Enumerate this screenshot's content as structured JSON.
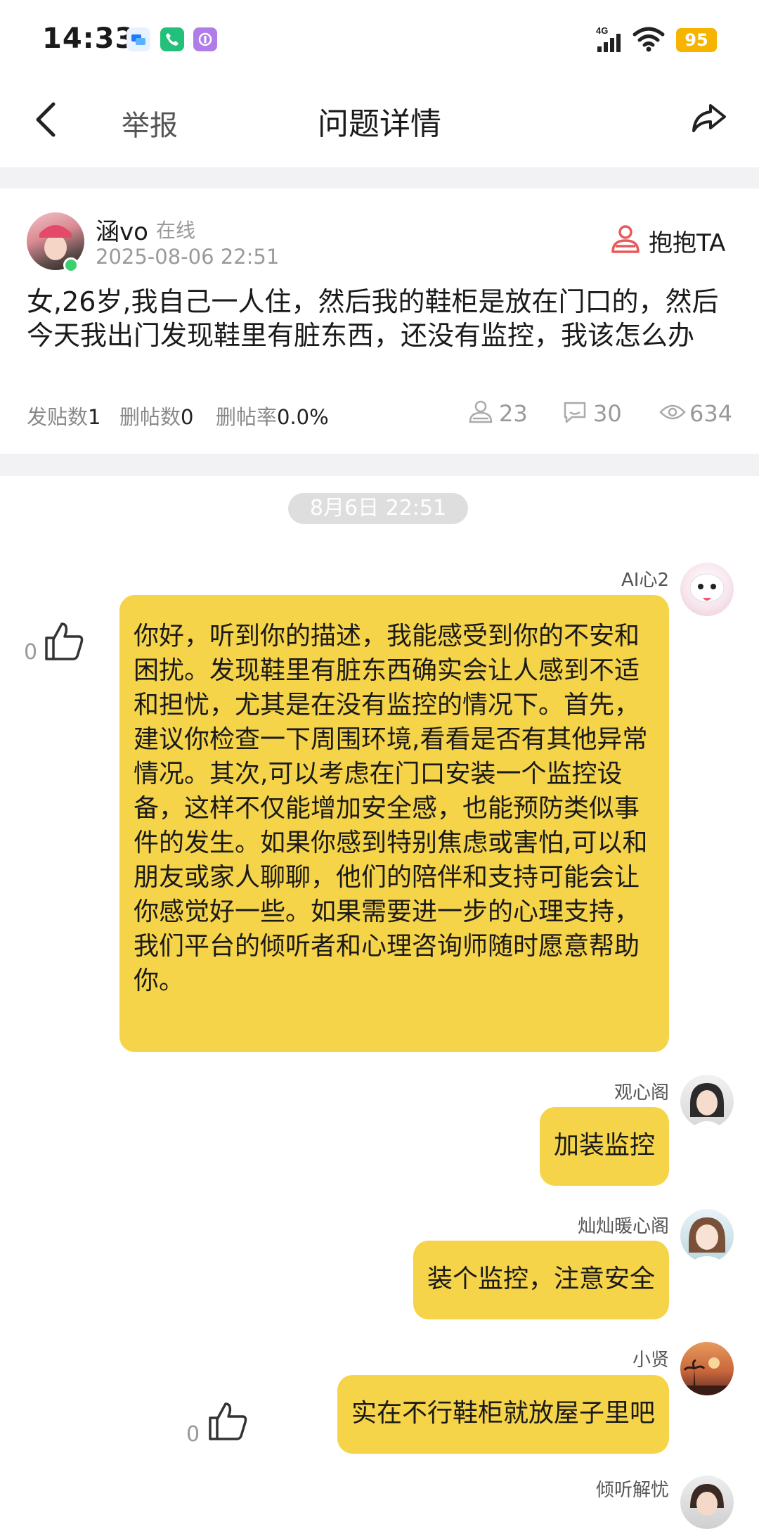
{
  "status_bar": {
    "time": "14:33",
    "battery": "95"
  },
  "nav": {
    "title": "问题详情",
    "report_label": "举报"
  },
  "post": {
    "username": "涵vo",
    "online_status": "在线",
    "timestamp": "2025-08-06 22:51",
    "hug_label": "抱抱TA",
    "content": "女,26岁,我自己一人住，然后我的鞋柜是放在门口的，然后今天我出门发现鞋里有脏东西，还没有监控，我该怎么办",
    "stats": {
      "posts_label": "发贴数",
      "posts_value": "1",
      "deleted_label": "删帖数",
      "deleted_value": "0",
      "delete_rate_label": "删帖率",
      "delete_rate_value": "0.0%"
    },
    "hug_count": "23",
    "comment_count": "30",
    "view_count": "634"
  },
  "chat": {
    "date": "8月6日 22:51",
    "messages": [
      {
        "sender": "AI心2",
        "text": "你好，听到你的描述，我能感受到你的不安和困扰。发现鞋里有脏东西确实会让人感到不适和担忧，尤其是在没有监控的情况下。首先，建议你检查一下周围环境,看看是否有其他异常情况。其次,可以考虑在门口安装一个监控设备，这样不仅能增加安全感，也能预防类似事件的发生。如果你感到特别焦虑或害怕,可以和朋友或家人聊聊，他们的陪伴和支持可能会让你感觉好一些。如果需要进一步的心理支持，我们平台的倾听者和心理咨询师随时愿意帮助你。",
        "likes": "0"
      },
      {
        "sender": "观心阁",
        "text": "加装监控"
      },
      {
        "sender": "灿灿暖心阁",
        "text": "装个监控，注意安全"
      },
      {
        "sender": "小贤",
        "text": "实在不行鞋柜就放屋子里吧",
        "likes": "0"
      },
      {
        "sender": "倾听解忧"
      }
    ]
  },
  "colors": {
    "bubble": "#f6d44a",
    "accent_red": "#e85a5a",
    "online_dot": "#3ccf6e"
  }
}
